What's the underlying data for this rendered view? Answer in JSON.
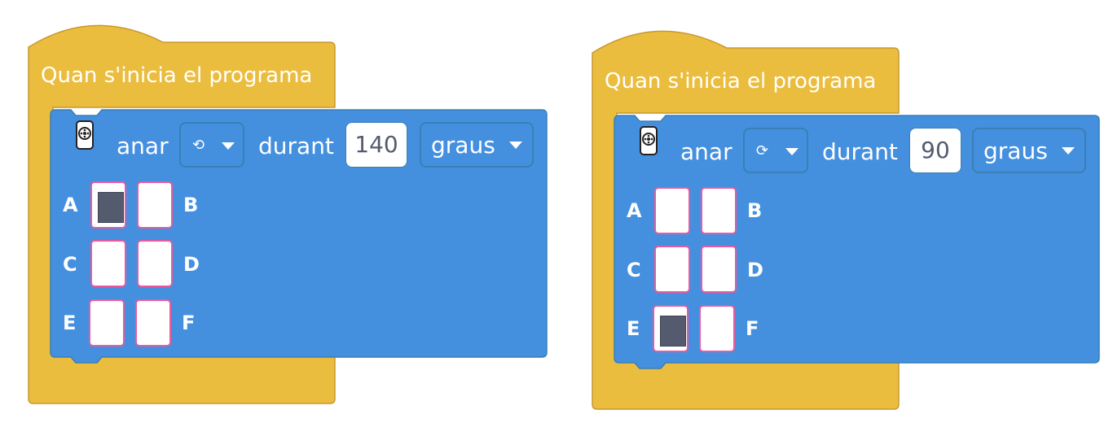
{
  "colors": {
    "hat": "#ebbd3f",
    "hat_border": "#c8982c",
    "motor_block": "#4490df",
    "motor_block_border": "#3a7fb5",
    "port_border": "#ea5aa0",
    "port_checked": "#545b6e"
  },
  "programs": [
    {
      "hat_label": "Quan s'inicia el programa",
      "motor_icon": "motor-pair-icon",
      "go_label": "anar",
      "direction_icon": "counterclockwise-icon",
      "direction_glyph": "⟲",
      "for_label": "durant",
      "amount": "140",
      "unit": "graus",
      "ports": [
        {
          "letter": "A",
          "checked": true
        },
        {
          "letter": "B",
          "checked": false
        },
        {
          "letter": "C",
          "checked": false
        },
        {
          "letter": "D",
          "checked": false
        },
        {
          "letter": "E",
          "checked": false
        },
        {
          "letter": "F",
          "checked": false
        }
      ]
    },
    {
      "hat_label": "Quan s'inicia el programa",
      "motor_icon": "motor-pair-icon",
      "go_label": "anar",
      "direction_icon": "clockwise-icon",
      "direction_glyph": "⟳",
      "for_label": "durant",
      "amount": "90",
      "unit": "graus",
      "ports": [
        {
          "letter": "A",
          "checked": false
        },
        {
          "letter": "B",
          "checked": false
        },
        {
          "letter": "C",
          "checked": false
        },
        {
          "letter": "D",
          "checked": false
        },
        {
          "letter": "E",
          "checked": true
        },
        {
          "letter": "F",
          "checked": false
        }
      ]
    }
  ]
}
